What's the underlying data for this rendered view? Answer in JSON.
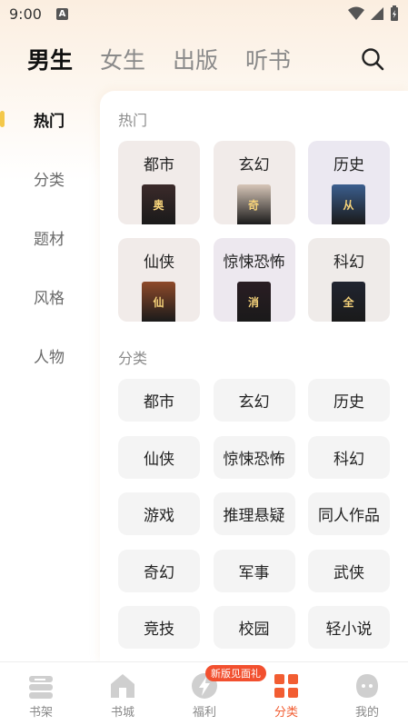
{
  "status_bar": {
    "time": "9:00",
    "notification_glyph": "A"
  },
  "top_tabs": [
    "男生",
    "女生",
    "出版",
    "听书"
  ],
  "sidebar": {
    "items": [
      "热门",
      "分类",
      "题材",
      "风格",
      "人物"
    ]
  },
  "hot_section": {
    "title": "热门",
    "cards": [
      {
        "label": "都市",
        "bg": "#f1ebe9",
        "cover": "#3b2a2a",
        "cover_text": "奥"
      },
      {
        "label": "玄幻",
        "bg": "#f1ebe9",
        "cover": "#d7c6b8",
        "cover_text": "奇"
      },
      {
        "label": "历史",
        "bg": "#ebe8f1",
        "cover": "#3b5e8e",
        "cover_text": "从"
      },
      {
        "label": "仙侠",
        "bg": "#f1ebe9",
        "cover": "#8e4a2a",
        "cover_text": "仙"
      },
      {
        "label": "惊悚恐怖",
        "bg": "#ede8ef",
        "cover": "#2a1d23",
        "cover_text": "消"
      },
      {
        "label": "科幻",
        "bg": "#efebe9",
        "cover": "#202430",
        "cover_text": "全"
      }
    ]
  },
  "category_section": {
    "title": "分类",
    "items": [
      "都市",
      "玄幻",
      "历史",
      "仙侠",
      "惊悚恐怖",
      "科幻",
      "游戏",
      "推理悬疑",
      "同人作品",
      "奇幻",
      "军事",
      "武侠",
      "竞技",
      "校园",
      "轻小说"
    ]
  },
  "bottom_nav": {
    "items": [
      {
        "label": "书架",
        "icon": "bookshelf-icon"
      },
      {
        "label": "书城",
        "icon": "bookstore-icon"
      },
      {
        "label": "福利",
        "icon": "welfare-icon"
      },
      {
        "label": "分类",
        "icon": "category-icon"
      },
      {
        "label": "我的",
        "icon": "profile-icon"
      }
    ],
    "badge": "新版见面礼",
    "active_color": "#f25d32"
  }
}
